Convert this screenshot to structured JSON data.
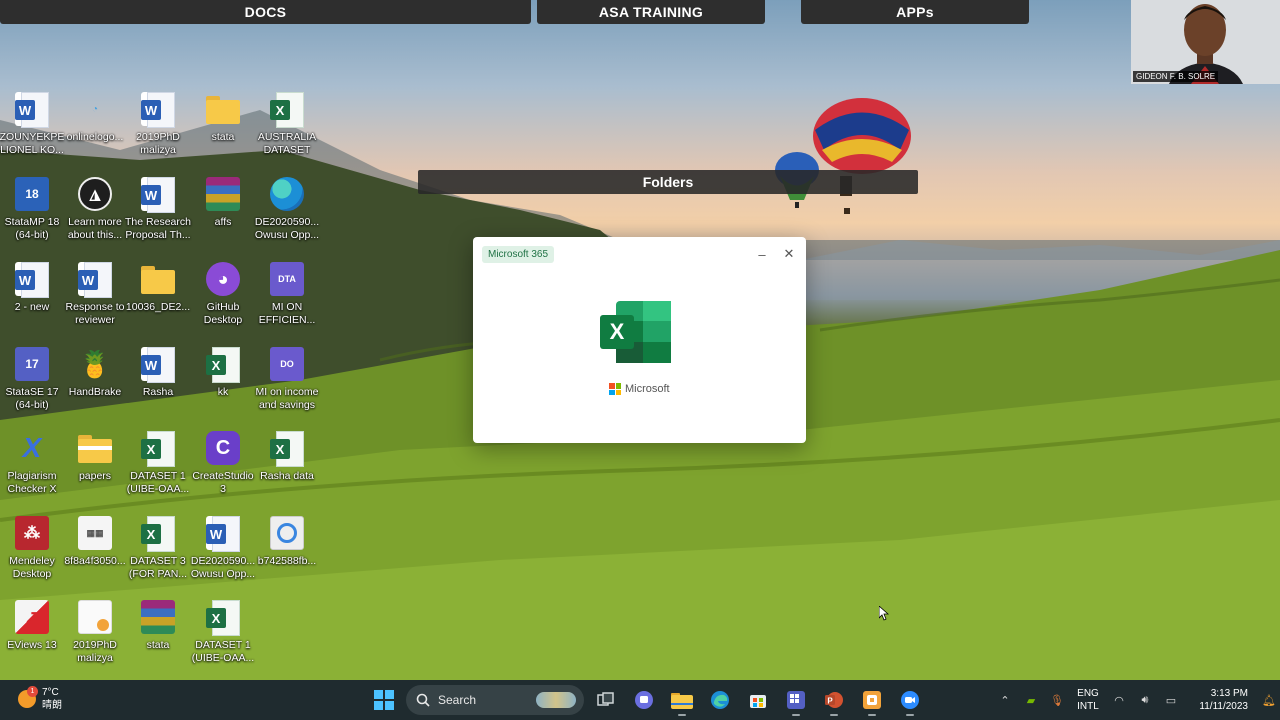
{
  "top_bars": {
    "docs": "DOCS",
    "asa_training": "ASA TRAINING",
    "apps": "APPs"
  },
  "folders_bar": "Folders",
  "webcam": {
    "participant_name": "GIDEON F. B. SOLRE"
  },
  "desktop_icons": [
    {
      "label": "ZOUNYEKPE\nLIONEL KO...",
      "icon": "word-doc-icon"
    },
    {
      "label": "onlinelogo...",
      "icon": "image-file-icon"
    },
    {
      "label": "2019PhD\nmalizya",
      "icon": "word-doc-icon"
    },
    {
      "label": "stata",
      "icon": "folder-icon"
    },
    {
      "label": "AUSTRALIA\nDATASET",
      "icon": "excel-file-icon"
    },
    {
      "label": "StataMP 18\n(64-bit)",
      "icon": "stata-icon",
      "badge": "18"
    },
    {
      "label": "Learn more\nabout this...",
      "icon": "learn-more-icon"
    },
    {
      "label": "The Research\nProposal Th...",
      "icon": "word-doc-icon"
    },
    {
      "label": "affs",
      "icon": "winrar-icon"
    },
    {
      "label": "DE2020590...\nOwusu Opp...",
      "icon": "edge-icon"
    },
    {
      "label": "2 - new",
      "icon": "word-doc-icon"
    },
    {
      "label": "Response to\nreviewer",
      "icon": "word-doc-icon"
    },
    {
      "label": "10036_DE2...",
      "icon": "folder-icon"
    },
    {
      "label": "GitHub\nDesktop",
      "icon": "github-icon"
    },
    {
      "label": "MI ON\nEFFICIEN...",
      "icon": "stata-data-icon",
      "badge": "DTA"
    },
    {
      "label": "StataSE 17\n(64-bit)",
      "icon": "stata-icon",
      "badge": "17"
    },
    {
      "label": "HandBrake",
      "icon": "handbrake-icon"
    },
    {
      "label": "Rasha",
      "icon": "word-doc-icon"
    },
    {
      "label": "kk",
      "icon": "excel-file-icon"
    },
    {
      "label": "MI on income\nand savings",
      "icon": "stata-data-icon",
      "badge": "DO"
    },
    {
      "label": "Plagiarism\nChecker X",
      "icon": "plagiarism-icon"
    },
    {
      "label": "papers",
      "icon": "folder-icon"
    },
    {
      "label": "DATASET 1\n(UIBE-OAA...",
      "icon": "excel-file-icon"
    },
    {
      "label": "CreateStudio\n3",
      "icon": "createstudio-icon"
    },
    {
      "label": "Rasha data",
      "icon": "excel-file-icon"
    },
    {
      "label": "Mendeley\nDesktop",
      "icon": "mendeley-icon"
    },
    {
      "label": "8f8a4f3050...",
      "icon": "image-file-icon"
    },
    {
      "label": "DATASET 3\n(FOR PAN...",
      "icon": "excel-file-icon"
    },
    {
      "label": "DE2020590...\nOwusu Opp...",
      "icon": "word-doc-icon"
    },
    {
      "label": "b742588fb...",
      "icon": "image-file-icon"
    },
    {
      "label": "EViews 13",
      "icon": "eviews-icon"
    },
    {
      "label": "2019PhD\nmalizya",
      "icon": "pdf-file-icon"
    },
    {
      "label": "stata",
      "icon": "winrar-icon"
    },
    {
      "label": "DATASET 1\n(UIBE-OAA...",
      "icon": "excel-file-icon"
    }
  ],
  "splash": {
    "badge": "Microsoft 365",
    "brand": "Microsoft",
    "minimize": "–",
    "close": "✕",
    "excel_letter": "X"
  },
  "taskbar": {
    "weather": {
      "temp": "7°C",
      "condition": "晴朗",
      "alert": "1"
    },
    "search_placeholder": "Search",
    "apps": [
      "windows-start-icon",
      "search-icon",
      "task-view-icon",
      "teams-icon",
      "file-explorer-icon",
      "edge-icon",
      "store-icon",
      "stata-icon",
      "powerpoint-icon",
      "ms365-icon",
      "zoom-icon"
    ],
    "language": {
      "line1": "ENG",
      "line2": "INTL"
    },
    "clock": {
      "time": "3:13 PM",
      "date": "11/11/2023"
    }
  },
  "colors": {
    "accent_excel": "#1d7044",
    "taskbar": "#1f2b2f",
    "bar": "#2e2e2e"
  }
}
